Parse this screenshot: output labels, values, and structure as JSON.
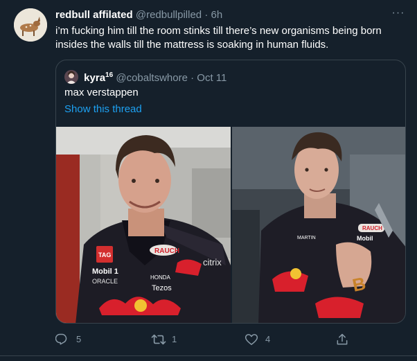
{
  "tweet": {
    "author_name": "redbull affilated",
    "handle": "@redbullpilled",
    "separator": "·",
    "time": "6h",
    "more_label": "···",
    "text": "i’m fucking him till the room stinks till there’s new organisms being born insides the walls till the mattress is soaking in human fluids."
  },
  "quote": {
    "author_name": "kyra",
    "author_sup": "16",
    "handle": "@cobaltswhore",
    "separator": "·",
    "date": "Oct 11",
    "text": "max verstappen",
    "show_thread": "Show this thread",
    "image_texts": {
      "left": {
        "sponsor1": "RAUCH",
        "sponsor2": "Mobil 1",
        "sponsor3": "ORACLE",
        "sponsor4": "HONDA",
        "sponsor5": "Tezos",
        "sponsor6": "citrix",
        "sponsor7": "TAG"
      },
      "right": {
        "sponsor1": "MARTIN",
        "sponsor2": "Mobil",
        "sponsor3": "RAUCH"
      }
    }
  },
  "actions": {
    "reply_count": "5",
    "retweet_count": "1",
    "like_count": "4"
  },
  "icons": {
    "reply": "reply-icon",
    "retweet": "retweet-icon",
    "like": "heart-icon",
    "share": "share-icon",
    "more": "more-icon"
  },
  "colors": {
    "background": "#15202b",
    "border": "#38444d",
    "muted": "#8899a6",
    "link": "#1da1f2",
    "text": "#ffffff"
  }
}
